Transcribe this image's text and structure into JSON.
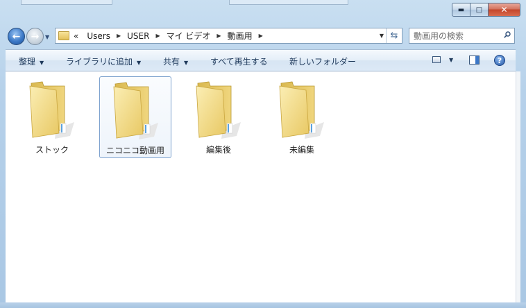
{
  "window": {
    "minimize_glyph": "▬",
    "maximize_glyph": "□",
    "close_glyph": "✕"
  },
  "nav": {
    "back_glyph": "←",
    "forward_glyph": "→"
  },
  "address": {
    "overflow": "«",
    "crumbs": [
      "Users",
      "USER",
      "マイ ビデオ",
      "動画用"
    ],
    "separator": "▶"
  },
  "search": {
    "placeholder": "動画用の検索"
  },
  "toolbar": {
    "organize": "整理",
    "add_to_library": "ライブラリに追加",
    "share": "共有",
    "play_all": "すべて再生する",
    "new_folder": "新しいフォルダー",
    "help": "?"
  },
  "folders": [
    {
      "label": "ストック",
      "selected": false
    },
    {
      "label": "ニコニコ動画用",
      "selected": true
    },
    {
      "label": "編集後",
      "selected": false
    },
    {
      "label": "未編集",
      "selected": false
    }
  ],
  "colors": {
    "selection_border": "#7da2ce",
    "folder_front": "#f3dd8c",
    "folder_back": "#e2c460",
    "accent_blue": "#3c78c8"
  },
  "icons": {
    "folder": "folder-icon",
    "search": "search-icon",
    "refresh": "refresh-icon",
    "help": "help-icon",
    "view": "view-icon",
    "preview_pane": "preview-pane-icon"
  }
}
